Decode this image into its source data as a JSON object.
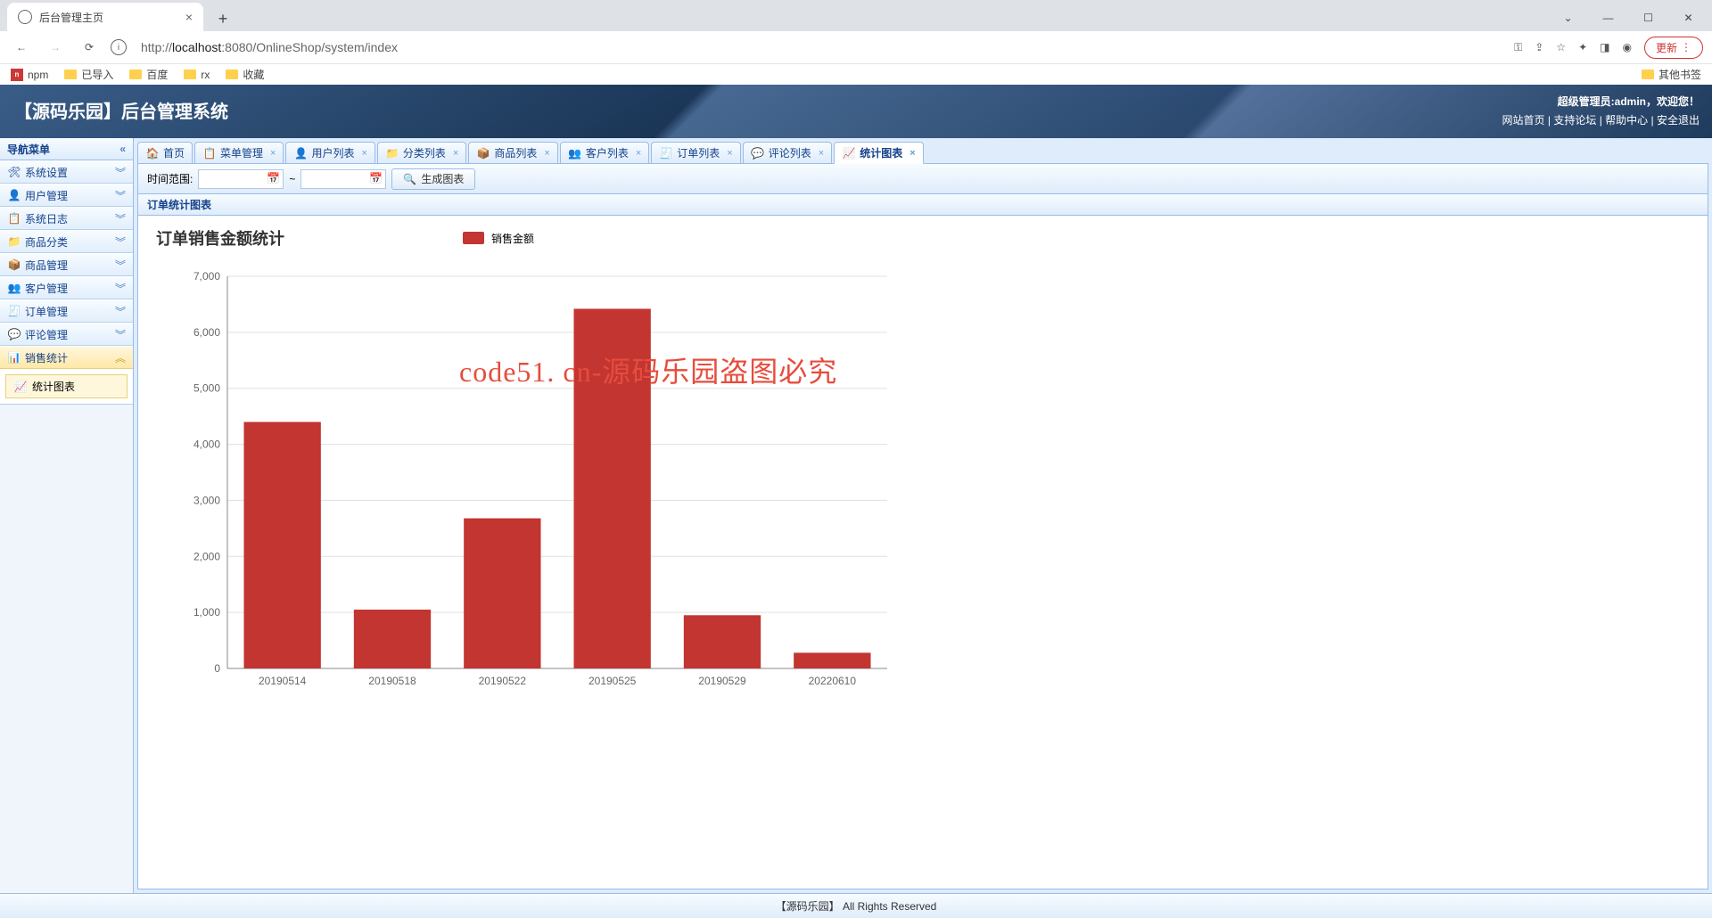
{
  "browser": {
    "tab_title": "后台管理主页",
    "url_prefix": "http://",
    "url_host": "localhost",
    "url_port": ":8080",
    "url_path": "/OnlineShop/system/index",
    "update_label": "更新",
    "bookmarks": [
      "npm",
      "已导入",
      "百度",
      "rx",
      "收藏"
    ],
    "other_bookmarks": "其他书签"
  },
  "header": {
    "title": "【源码乐园】后台管理系统",
    "admin_prefix": "超级管理员:",
    "admin_name": "admin",
    "welcome_suffix": "，欢迎您！",
    "links": [
      "网站首页",
      "支持论坛",
      "帮助中心",
      "安全退出"
    ]
  },
  "sidebar": {
    "nav_title": "导航菜单",
    "items": [
      "系统设置",
      "用户管理",
      "系统日志",
      "商品分类",
      "商品管理",
      "客户管理",
      "订单管理",
      "评论管理",
      "销售统计"
    ],
    "sub_item": "统计图表"
  },
  "tabs": [
    {
      "label": "首页",
      "closable": false
    },
    {
      "label": "菜单管理",
      "closable": true
    },
    {
      "label": "用户列表",
      "closable": true
    },
    {
      "label": "分类列表",
      "closable": true
    },
    {
      "label": "商品列表",
      "closable": true
    },
    {
      "label": "客户列表",
      "closable": true
    },
    {
      "label": "订单列表",
      "closable": true
    },
    {
      "label": "评论列表",
      "closable": true
    },
    {
      "label": "统计图表",
      "closable": true,
      "active": true
    }
  ],
  "toolbar": {
    "range_label": "时间范围:",
    "to_label": "~",
    "gen_btn": "生成图表"
  },
  "panel_title": "订单统计图表",
  "watermark": "code51. cn-源码乐园盗图必究",
  "footer": "【源码乐园】 All Rights Reserved",
  "chart_data": {
    "type": "bar",
    "title": "订单销售金额统计",
    "legend": "销售金额",
    "categories": [
      "20190514",
      "20190518",
      "20190522",
      "20190525",
      "20190529",
      "20220610"
    ],
    "values": [
      4400,
      1050,
      2680,
      6420,
      950,
      280
    ],
    "ylim": [
      0,
      7000
    ],
    "ystep": 1000,
    "xlabel": "",
    "ylabel": ""
  }
}
